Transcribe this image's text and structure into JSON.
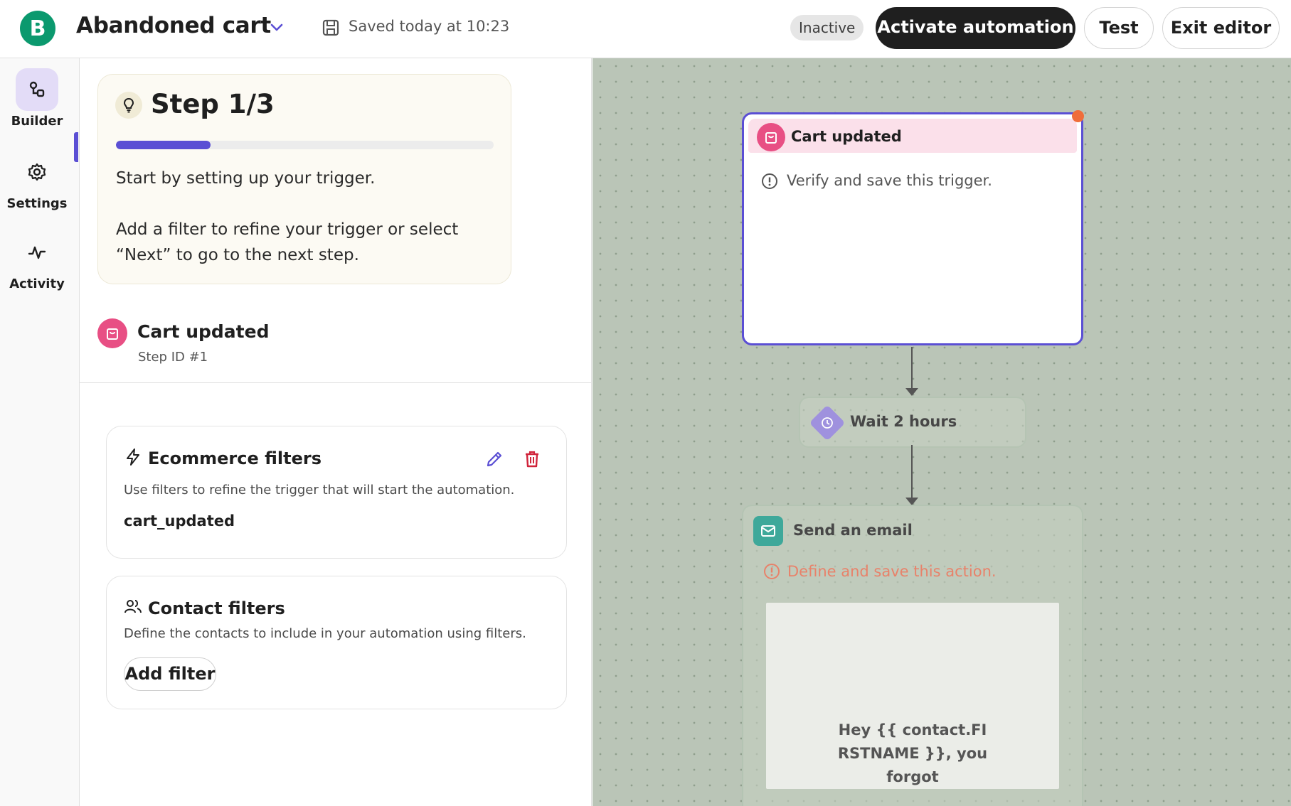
{
  "header": {
    "logo_letter": "B",
    "title": "Abandoned cart",
    "saved_text": "Saved today at 10:23",
    "status_badge": "Inactive",
    "activate_label": "Activate automation",
    "test_label": "Test",
    "exit_label": "Exit editor"
  },
  "nav": {
    "items": [
      {
        "label": "Builder",
        "icon": "workflow-icon",
        "active": true
      },
      {
        "label": "Settings",
        "icon": "gear-icon",
        "active": false
      },
      {
        "label": "Activity",
        "icon": "activity-icon",
        "active": false
      }
    ]
  },
  "panel": {
    "tip": {
      "title": "Step 1/3",
      "progress": 0.25,
      "line1": "Start by setting up your trigger.",
      "line2": "Add a filter to refine your trigger or select “Next” to go to the next step."
    },
    "step": {
      "name": "Cart updated",
      "id_label": "Step ID #1"
    },
    "ecommerce_filters": {
      "title": "Ecommerce filters",
      "description": "Use filters to refine the trigger that will start the automation.",
      "value": "cart_updated"
    },
    "contact_filters": {
      "title": "Contact filters",
      "description": "Define the contacts to include in your automation using filters.",
      "add_label": "Add filter"
    }
  },
  "canvas": {
    "trigger": {
      "title": "Cart updated",
      "warning": "Verify and save this trigger."
    },
    "wait": {
      "title": "Wait 2 hours"
    },
    "email": {
      "title": "Send an email",
      "warning": "Define and save this action.",
      "preview_text": "Hey {{ contact.FIRSTNAME }}, you forgot"
    }
  },
  "colors": {
    "accent": "#5b4fd4",
    "brand": "#0b996e",
    "trigger_pink": "#e84f84",
    "warning_orange": "#e8826a",
    "delete_red": "#d0243b",
    "canvas_bg": "#bac5b7"
  }
}
